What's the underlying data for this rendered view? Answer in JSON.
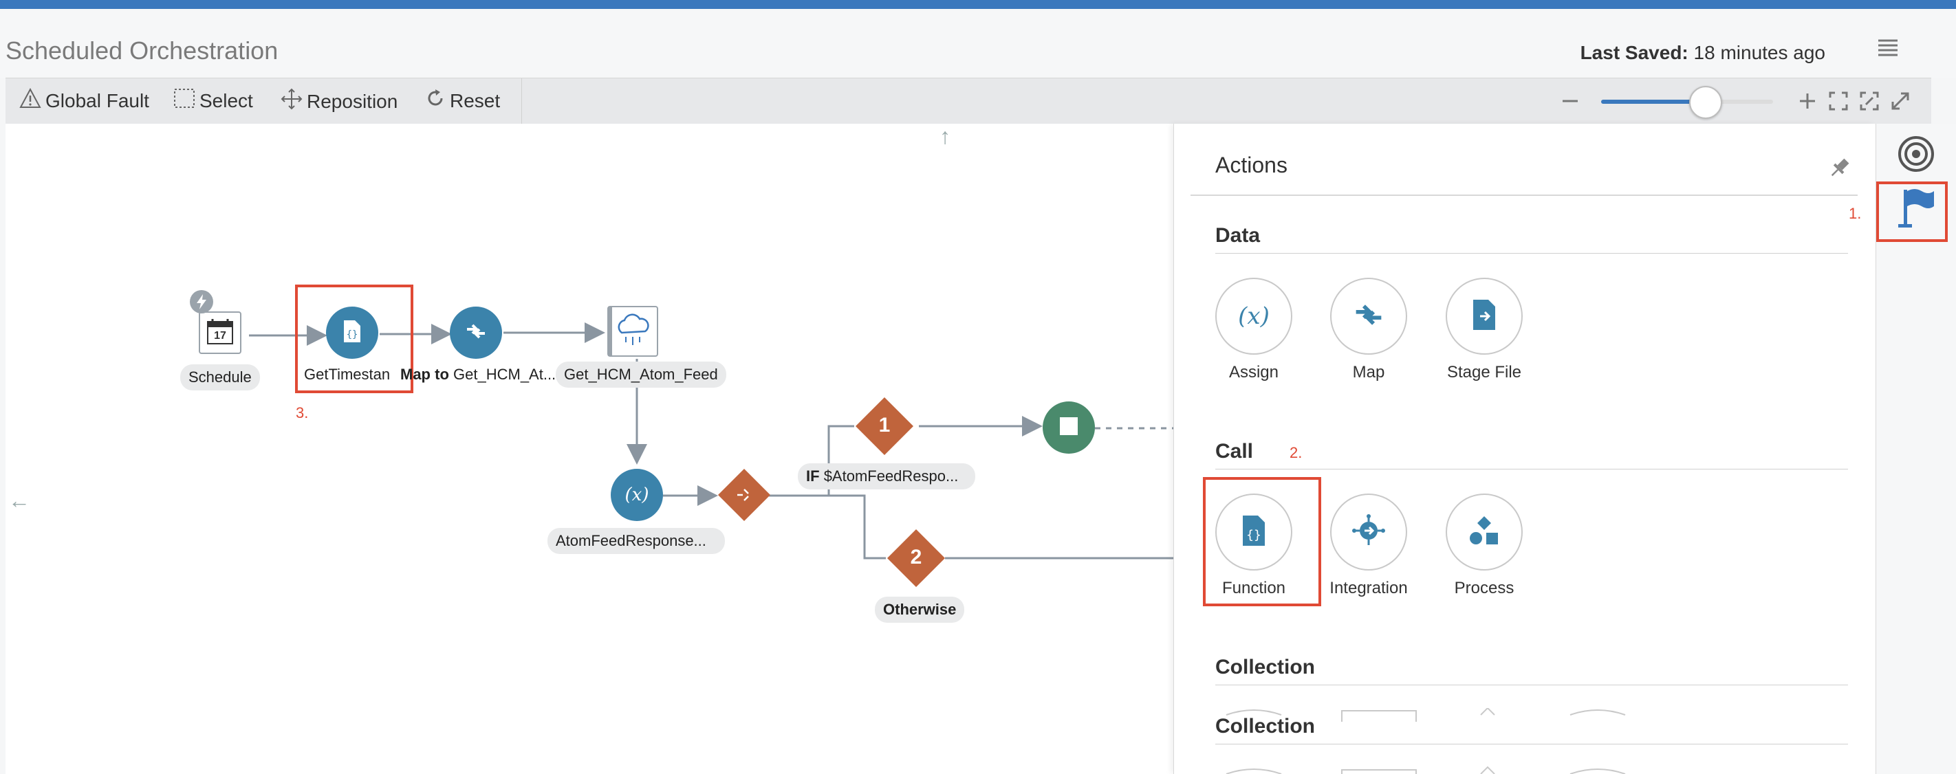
{
  "header": {
    "title": "Scheduled Orchestration",
    "last_saved_label": "Last Saved:",
    "last_saved_value": "18 minutes ago"
  },
  "toolbar": {
    "global_fault": "Global Fault",
    "select": "Select",
    "reposition": "Reposition",
    "reset": "Reset",
    "zoom_level": 0.6
  },
  "canvas": {
    "nodes": {
      "schedule": "Schedule",
      "calendar_day": "17",
      "get_timestamp": "GetTimestan",
      "map_prefix": "Map to",
      "map_name": "Get_HCM_At...",
      "invoke": "Get_HCM_Atom_Feed",
      "assign": "AtomFeedResponse...",
      "branch1_number": "1",
      "branch1_prefix": "IF",
      "branch1_condition": "$AtomFeedRespo...",
      "branch2_number": "2",
      "otherwise": "Otherwise"
    },
    "annotations": {
      "three": "3."
    },
    "arrows": {
      "up": "↑",
      "left": "←"
    }
  },
  "actions_panel": {
    "title": "Actions",
    "sections": {
      "data": "Data",
      "call": "Call",
      "collection_1": "Collection",
      "collection_2": "Collection"
    },
    "data_items": {
      "assign": "Assign",
      "map": "Map",
      "stage_file": "Stage File"
    },
    "call_items": {
      "function": "Function",
      "integration": "Integration",
      "process": "Process"
    },
    "annotations": {
      "two": "2."
    }
  },
  "right_rail": {
    "annotations": {
      "one": "1."
    }
  },
  "colors": {
    "accent_blue": "#3a78bd",
    "node_blue": "#3b83ab",
    "switch_orange": "#c0643c",
    "end_green": "#4a8a6c",
    "annotation_red": "#e04a35"
  }
}
